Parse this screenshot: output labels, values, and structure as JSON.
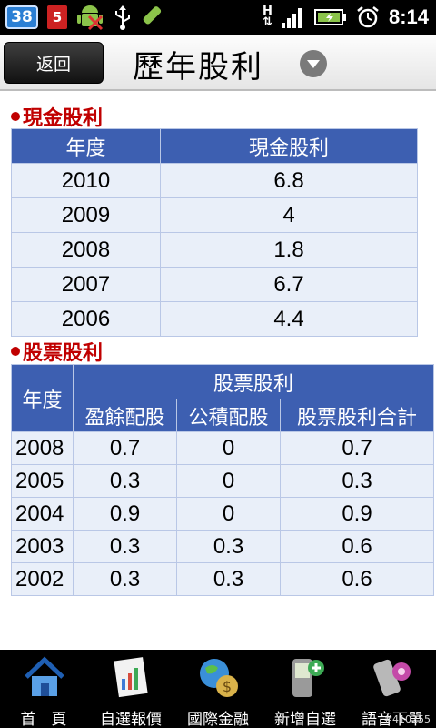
{
  "status_bar": {
    "notif_count": "38",
    "badge5": "5",
    "time": "8:14",
    "network": "H"
  },
  "header": {
    "back_label": "返回",
    "title": "歷年股利"
  },
  "cash_dividend": {
    "heading": "現金股利",
    "columns": [
      "年度",
      "現金股利"
    ],
    "rows": [
      [
        "2010",
        "6.8"
      ],
      [
        "2009",
        "4"
      ],
      [
        "2008",
        "1.8"
      ],
      [
        "2007",
        "6.7"
      ],
      [
        "2006",
        "4.4"
      ]
    ]
  },
  "stock_dividend": {
    "heading": "股票股利",
    "year_header": "年度",
    "group_header": "股票股利",
    "sub_columns": [
      "盈餘配股",
      "公積配股",
      "股票股利合計"
    ],
    "rows": [
      [
        "2008",
        "0.7",
        "0",
        "0.7"
      ],
      [
        "2005",
        "0.3",
        "0",
        "0.3"
      ],
      [
        "2004",
        "0.9",
        "0",
        "0.9"
      ],
      [
        "2003",
        "0.3",
        "0.3",
        "0.6"
      ],
      [
        "2002",
        "0.3",
        "0.3",
        "0.6"
      ]
    ]
  },
  "bottom_nav": {
    "items": [
      {
        "label": "首　頁",
        "icon": "home-icon"
      },
      {
        "label": "自選報價",
        "icon": "quote-chart-icon"
      },
      {
        "label": "國際金融",
        "icon": "globe-money-icon"
      },
      {
        "label": "新增自選",
        "icon": "phone-add-icon"
      },
      {
        "label": "語音下單",
        "icon": "phone-voice-icon"
      }
    ]
  },
  "watermark": "#410255",
  "colors": {
    "header_blue": "#3d5fb1",
    "cell_bg": "#e9eff9",
    "heading_red": "#c00000"
  }
}
